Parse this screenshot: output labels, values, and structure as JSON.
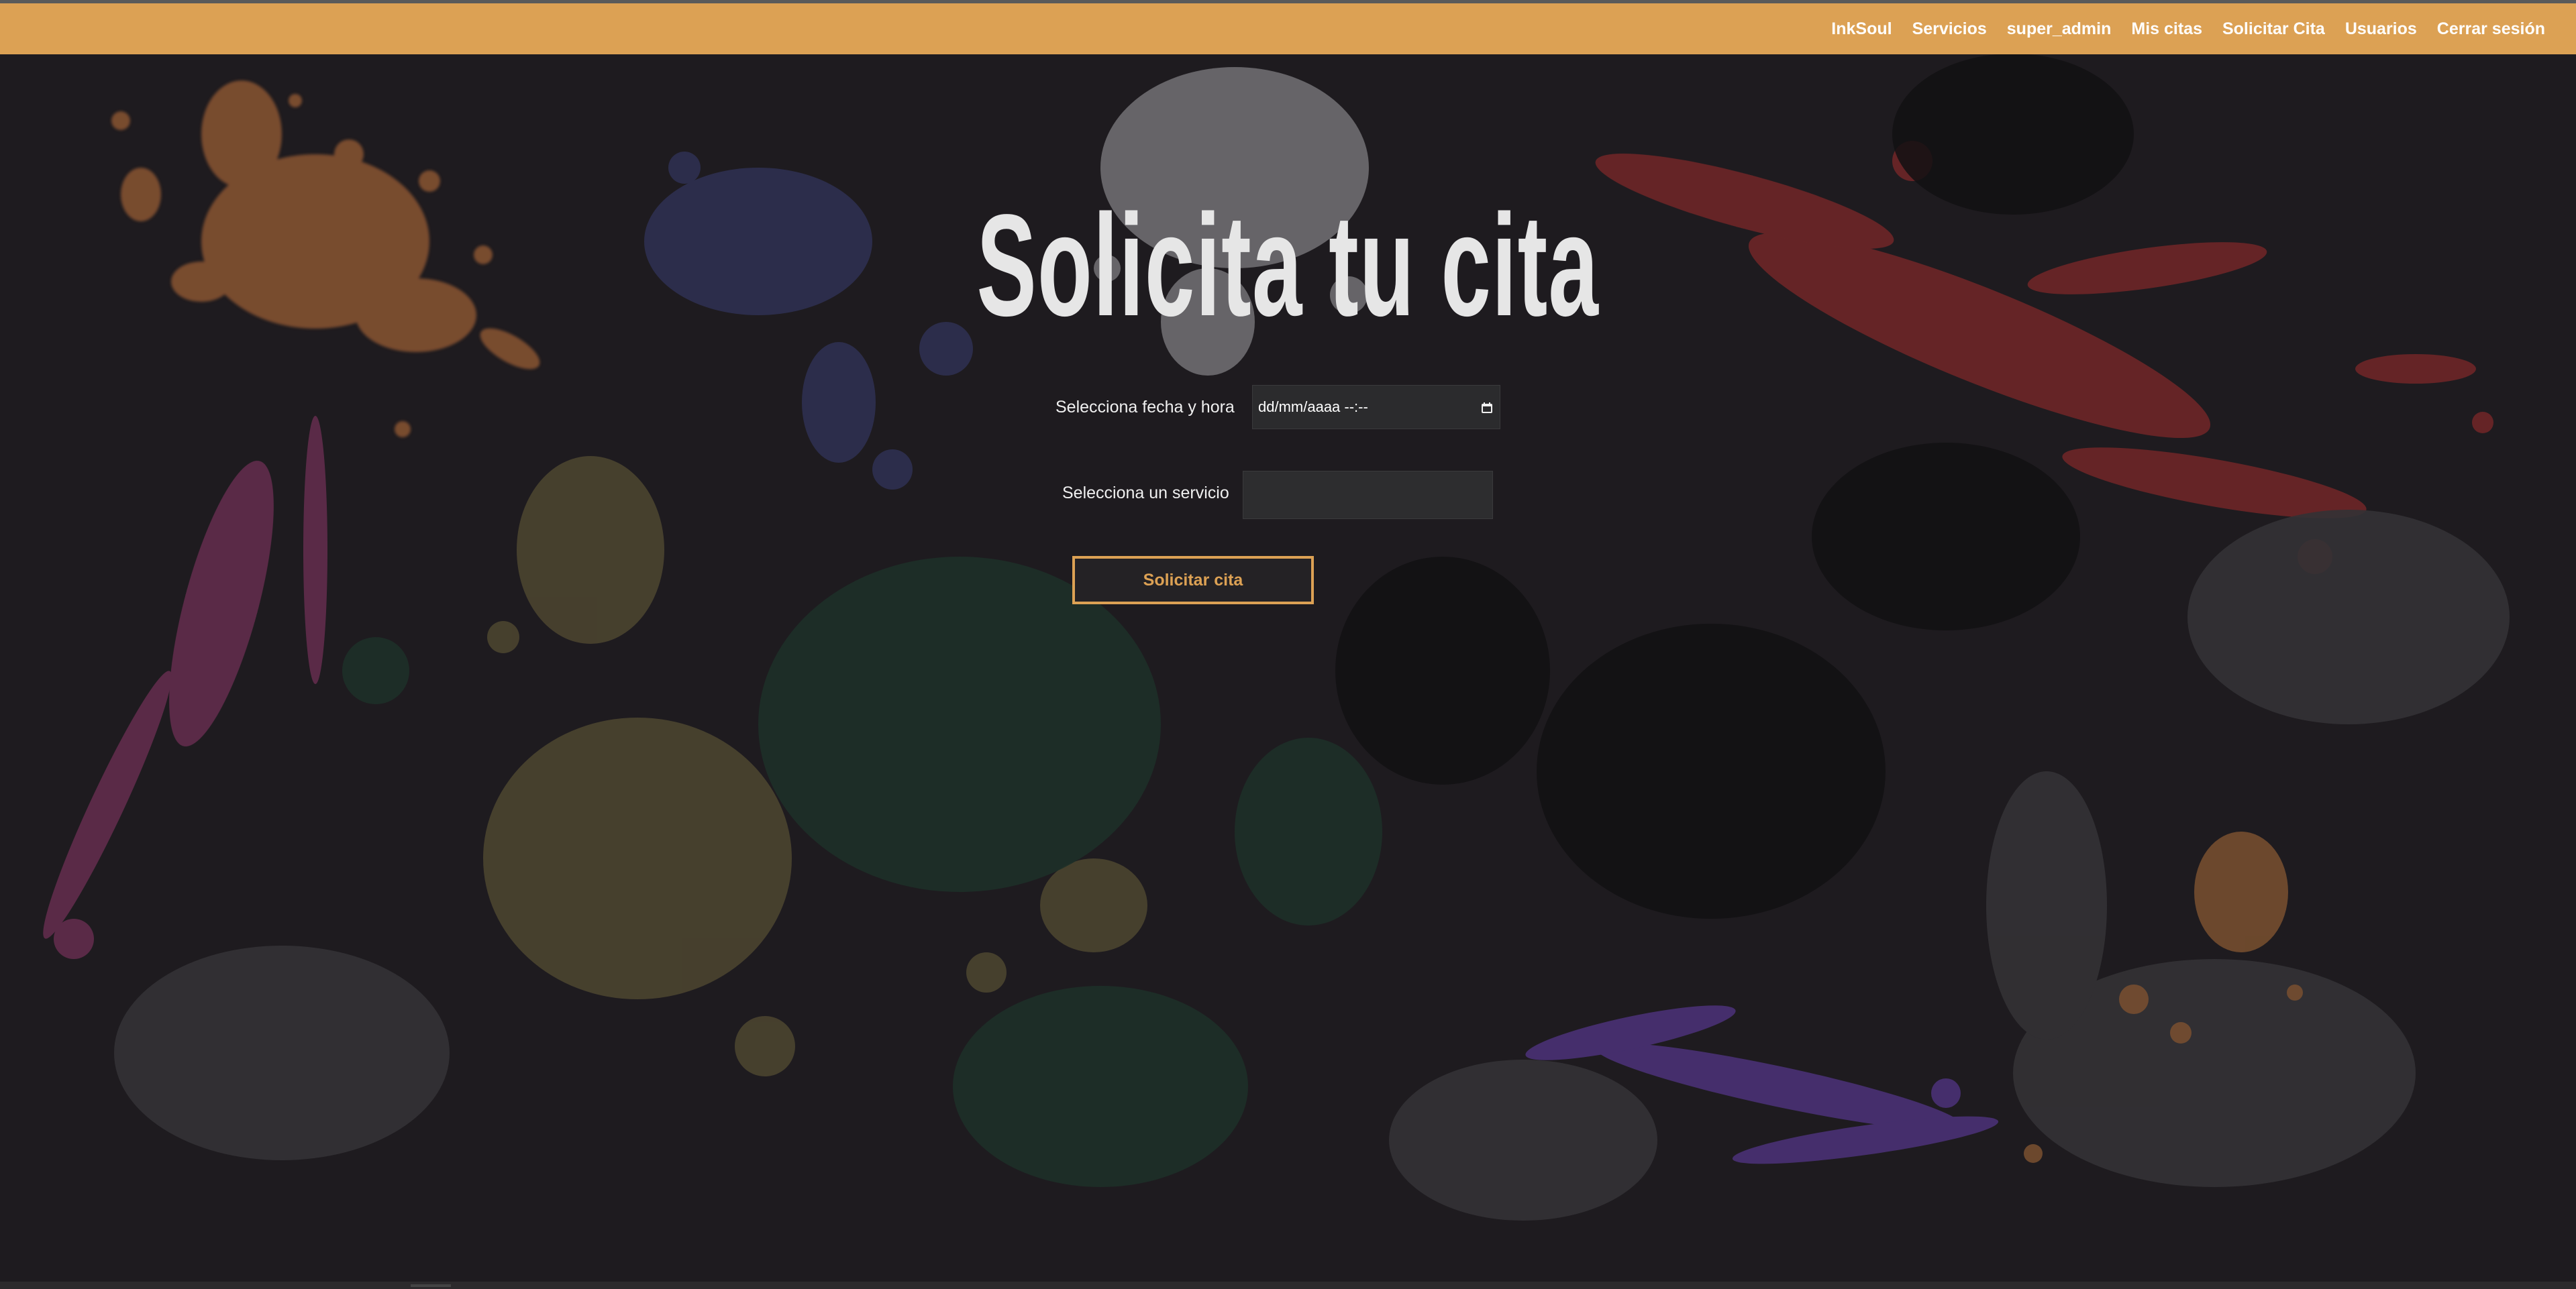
{
  "nav": {
    "links": [
      "InkSoul",
      "Servicios",
      "super_admin",
      "Mis citas",
      "Solicitar Cita",
      "Usuarios",
      "Cerrar sesión"
    ],
    "bar_color": "#dca154"
  },
  "main": {
    "title": "Solicita tu cita",
    "date_label": "Selecciona fecha y hora",
    "date_value": "dd/mm/aaaa --:--",
    "service_label": "Selecciona un servicio",
    "service_value": "",
    "submit_label": "Solicitar cita"
  },
  "icons": {
    "date_picker": "calendar-icon"
  },
  "colors": {
    "accent": "#dca154",
    "background": "#1e1b1f",
    "title": "#e6e6e6"
  }
}
